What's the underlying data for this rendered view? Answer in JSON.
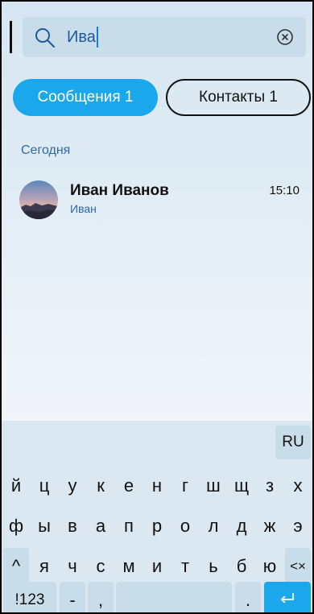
{
  "search": {
    "query": "Ива"
  },
  "tabs": [
    {
      "label": "Сообщения 1"
    },
    {
      "label": "Контакты 1"
    }
  ],
  "section_label": "Сегодня",
  "results": [
    {
      "name": "Иван Иванов",
      "preview": "Иван",
      "time": "15:10"
    }
  ],
  "keyboard": {
    "language": "RU",
    "row1": [
      "й",
      "ц",
      "у",
      "к",
      "е",
      "н",
      "г",
      "ш",
      "щ",
      "з",
      "х"
    ],
    "row2": [
      "ф",
      "ы",
      "в",
      "а",
      "п",
      "р",
      "о",
      "л",
      "д",
      "ж",
      "э"
    ],
    "row3": [
      "я",
      "ч",
      "с",
      "м",
      "и",
      "т",
      "ь",
      "б",
      "ю"
    ],
    "shift": "^",
    "backspace": "<×",
    "numbers": "!123",
    "dash": "-",
    "comma": ",",
    "period": "."
  },
  "colors": {
    "accent": "#1aa7ec",
    "link": "#2b6aa8"
  }
}
